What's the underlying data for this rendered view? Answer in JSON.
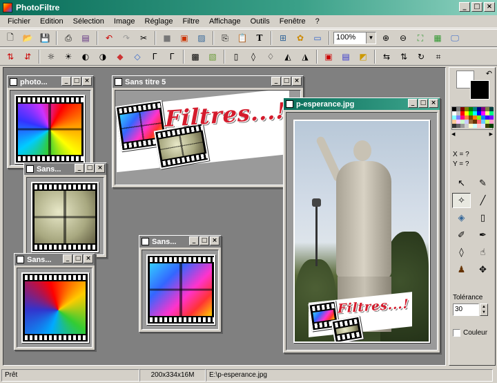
{
  "app": {
    "title": "PhotoFiltre"
  },
  "menu": [
    "Fichier",
    "Edition",
    "Sélection",
    "Image",
    "Réglage",
    "Filtre",
    "Affichage",
    "Outils",
    "Fenêtre",
    "?"
  ],
  "toolbar": {
    "zoom": "100%"
  },
  "windows": {
    "w1": {
      "title": "photo..."
    },
    "w2": {
      "title": "Sans titre 5",
      "logo_text": "Filtres...!"
    },
    "w3": {
      "title": "Sans..."
    },
    "w4": {
      "title": "Sans..."
    },
    "w5": {
      "title": "Sans..."
    },
    "w6": {
      "title": "p-esperance.jpg",
      "logo_text": "Filtres...!"
    }
  },
  "palette": {
    "x_label": "X = ?",
    "y_label": "Y = ?",
    "tolerance_label": "Tolérance",
    "tolerance_value": "30",
    "couleur_label": "Couleur",
    "colors": [
      "#000000",
      "#808080",
      "#800000",
      "#808000",
      "#008000",
      "#008080",
      "#000080",
      "#800080",
      "#808040",
      "#004040",
      "#ffffff",
      "#c0c0c0",
      "#ff0000",
      "#ffff00",
      "#00ff00",
      "#00ffff",
      "#0000ff",
      "#ff00ff",
      "#ffff80",
      "#00ff80",
      "#80ffff",
      "#8080ff",
      "#ff0080",
      "#ff8040",
      "#804000",
      "#ff8000",
      "#80ff00",
      "#0080ff",
      "#4000ff",
      "#8000ff",
      "#ffcc99",
      "#ffccff",
      "#ccffcc",
      "#ccccff",
      "#996633",
      "#663300",
      "#ff6666",
      "#66ccff",
      "#ccff66",
      "#ff99cc",
      "#333333",
      "#666666",
      "#999999",
      "#cccccc",
      "#ffffcc",
      "#ccffff",
      "#ffcccc",
      "#e0e0ff",
      "#404000",
      "#004000"
    ]
  },
  "status": {
    "state": "Prêt",
    "dimensions": "200x334x16M",
    "path": "E:\\p-esperance.jpg"
  }
}
